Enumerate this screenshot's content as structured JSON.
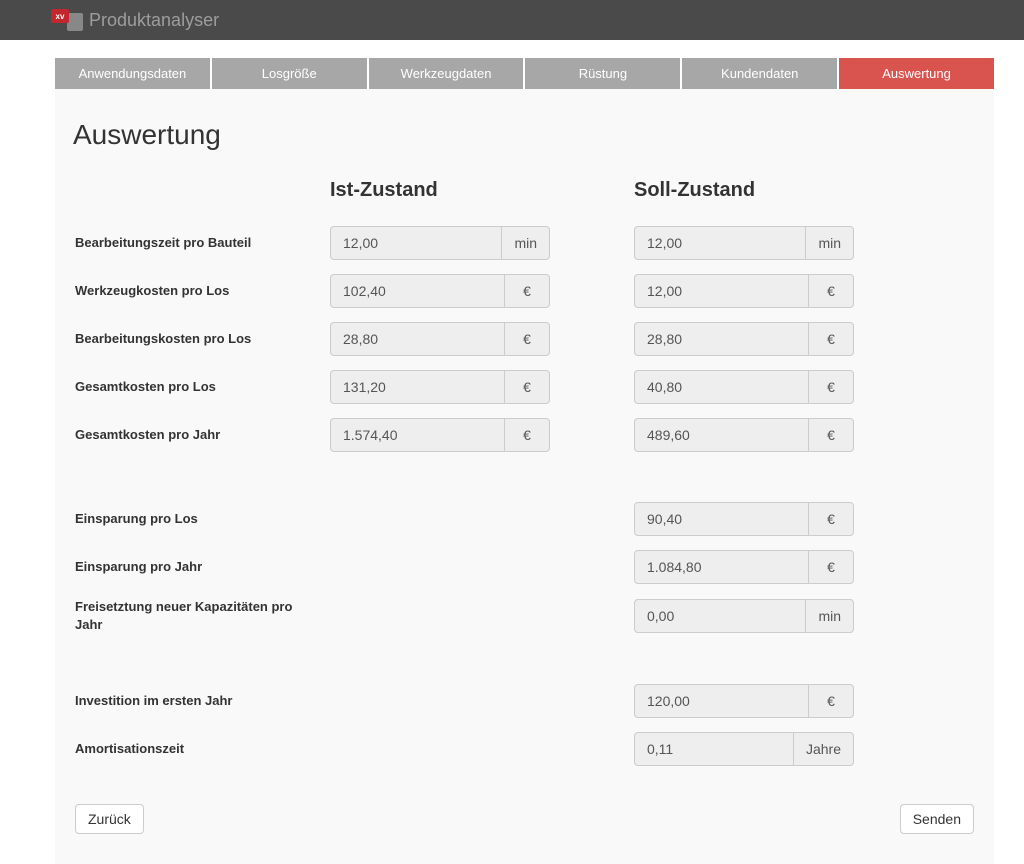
{
  "app": {
    "title": "Produktanalyser",
    "logoText": "xv"
  },
  "tabs": [
    {
      "label": "Anwendungsdaten"
    },
    {
      "label": "Losgröße"
    },
    {
      "label": "Werkzeugdaten"
    },
    {
      "label": "Rüstung"
    },
    {
      "label": "Kundendaten"
    },
    {
      "label": "Auswertung"
    }
  ],
  "page": {
    "title": "Auswertung"
  },
  "columns": {
    "ist": "Ist-Zustand",
    "soll": "Soll-Zustand"
  },
  "units": {
    "min": "min",
    "eur": "€",
    "jahre": "Jahre"
  },
  "rows": {
    "bearbeitungszeit": {
      "label": "Bearbeitungszeit pro Bauteil",
      "ist": "12,00",
      "soll": "12,00",
      "unit": "min"
    },
    "werkzeugkosten": {
      "label": "Werkzeugkosten pro Los",
      "ist": "102,40",
      "soll": "12,00",
      "unit": "eur"
    },
    "bearbeitungskosten": {
      "label": "Bearbeitungskosten pro Los",
      "ist": "28,80",
      "soll": "28,80",
      "unit": "eur"
    },
    "gesamtkostenLos": {
      "label": "Gesamtkosten pro Los",
      "ist": "131,20",
      "soll": "40,80",
      "unit": "eur"
    },
    "gesamtkostenJahr": {
      "label": "Gesamtkosten pro Jahr",
      "ist": "1.574,40",
      "soll": "489,60",
      "unit": "eur"
    },
    "einsparungLos": {
      "label": "Einsparung pro Los",
      "soll": "90,40",
      "unit": "eur"
    },
    "einsparungJahr": {
      "label": "Einsparung pro Jahr",
      "soll": "1.084,80",
      "unit": "eur"
    },
    "freisetzung": {
      "label": "Freisetztung neuer Kapazitäten pro Jahr",
      "soll": "0,00",
      "unit": "min"
    },
    "investition": {
      "label": "Investition im ersten Jahr",
      "soll": "120,00",
      "unit": "eur"
    },
    "amortisation": {
      "label": "Amortisationszeit",
      "soll": "0,11",
      "unit": "jahre"
    }
  },
  "buttons": {
    "back": "Zurück",
    "send": "Senden"
  }
}
